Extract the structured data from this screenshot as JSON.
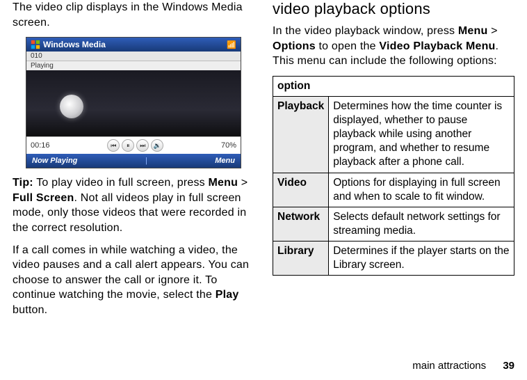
{
  "left": {
    "intro": "The video clip displays in the Windows Media screen.",
    "tip_label": "Tip:",
    "tip_pre": " To play video in full screen, press ",
    "tip_menu": "Menu",
    "tip_gt": " > ",
    "tip_full": "Full Screen",
    "tip_post": ". Not all videos play in full screen mode, only those videos that were recorded in the correct resolution.",
    "call_pre": "If a call comes in while watching a video, the video pauses and a call alert appears. You can choose to answer the call or ignore it. To continue watching the movie, select the ",
    "call_play": "Play",
    "call_post": " button."
  },
  "player": {
    "title": "Windows Media",
    "track_no": "010",
    "status": "Playing",
    "time": "00:16",
    "progress": "70%",
    "left_soft": "Now Playing",
    "right_soft": "Menu"
  },
  "right": {
    "heading": "video playback options",
    "lead_pre": "In the video playback window, press ",
    "lead_menu": "Menu",
    "lead_gt": " > ",
    "lead_options": "Options",
    "lead_mid": " to open the ",
    "lead_vpm": "Video Playback Menu",
    "lead_post": ". This menu can include the following options:",
    "table": {
      "header": "option",
      "rows": [
        {
          "label": "Playback",
          "desc": "Determines how the time counter is displayed, whether to pause playback while using another program, and whether to resume playback after a phone call."
        },
        {
          "label": "Video",
          "desc": "Options for displaying in full screen and when to scale to fit window."
        },
        {
          "label": "Network",
          "desc": "Selects default network settings for streaming media."
        },
        {
          "label": "Library",
          "desc": "Determines if the player starts on the Library screen."
        }
      ]
    }
  },
  "footer": {
    "section": "main attractions",
    "page": "39"
  }
}
